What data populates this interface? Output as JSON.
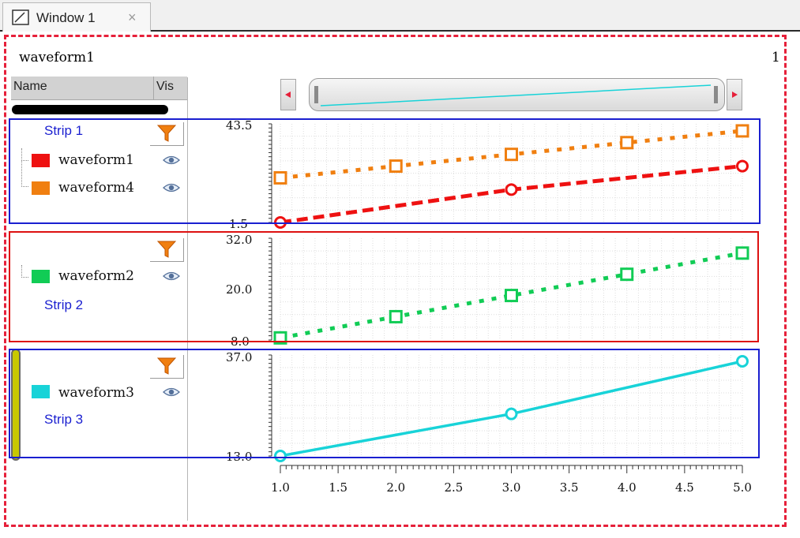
{
  "window": {
    "tab_title": "Window 1",
    "close_glyph": "×"
  },
  "header": {
    "title": "waveform1",
    "page_number": "1"
  },
  "panel": {
    "name_col": "Name",
    "vis_col": "Vis"
  },
  "strips": [
    {
      "label": "Strip 1",
      "y_top_label": "43.5",
      "y_bottom_label": "1.5"
    },
    {
      "label": "Strip 2",
      "y_top_label": "32.0",
      "y_mid_label": "20.0",
      "y_bottom_label": "8.0"
    },
    {
      "label": "Strip 3",
      "y_top_label": "37.0",
      "y_bottom_label": "13.0"
    }
  ],
  "legend": [
    {
      "name": "waveform1",
      "color": "#ee1111"
    },
    {
      "name": "waveform4",
      "color": "#f07f10"
    },
    {
      "name": "waveform2",
      "color": "#11cc55"
    },
    {
      "name": "waveform3",
      "color": "#18d3d8"
    }
  ],
  "icons": {
    "filter": "filter-icon",
    "visibility": "eye-icon",
    "tab": "window-icon"
  },
  "colors": {
    "frame": "#e6203a",
    "strip1_box": "#1a1fd0",
    "strip2_box": "#dd1111",
    "strip3_box": "#1a1fd0",
    "strip_label": "#1a1fd0"
  },
  "x_axis": {
    "ticks": [
      "1.0",
      "1.5",
      "2.0",
      "2.5",
      "3.0",
      "3.5",
      "4.0",
      "4.5",
      "5.0"
    ]
  },
  "chart_data": [
    {
      "type": "line",
      "x": [
        1,
        2,
        3,
        4,
        5
      ],
      "xlim": [
        1.0,
        5.0
      ],
      "ylim": [
        1.5,
        43.5
      ],
      "grid": true,
      "series": [
        {
          "name": "waveform1",
          "values": [
            1.5,
            null,
            15.5,
            null,
            25.5
          ],
          "style": "dashed",
          "marker": "circle",
          "color": "#ee1111"
        },
        {
          "name": "waveform4",
          "values": [
            20.5,
            25.5,
            30.5,
            35.5,
            40.5
          ],
          "style": "dotted",
          "marker": "square",
          "color": "#f07f10"
        }
      ]
    },
    {
      "type": "line",
      "x": [
        1,
        2,
        3,
        4,
        5
      ],
      "xlim": [
        1.0,
        5.0
      ],
      "ylim": [
        8.0,
        32.0
      ],
      "grid": true,
      "series": [
        {
          "name": "waveform2",
          "values": [
            8.5,
            13.5,
            18.5,
            23.5,
            28.5
          ],
          "style": "dotted",
          "marker": "square",
          "color": "#11cc55"
        }
      ]
    },
    {
      "type": "line",
      "x": [
        1,
        3,
        5
      ],
      "xlim": [
        1.0,
        5.0
      ],
      "ylim": [
        13.0,
        37.0
      ],
      "grid": true,
      "series": [
        {
          "name": "waveform3",
          "values": [
            13.0,
            23.0,
            35.5
          ],
          "style": "solid",
          "marker": "circle",
          "color": "#18d3d8"
        }
      ]
    }
  ]
}
